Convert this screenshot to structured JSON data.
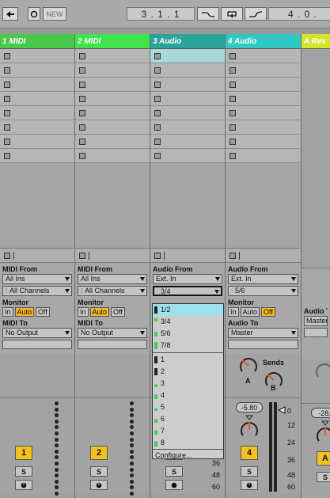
{
  "transport": {
    "back_icon": "arrow-left-icon",
    "overdub_icon": "circle-icon",
    "new_label": "NEW",
    "position_1": "3 .  1 .  1",
    "position_2": "4 .  0 ."
  },
  "tracks": [
    {
      "name": "1 MIDI",
      "color": "#49c94b",
      "number": "1"
    },
    {
      "name": "2 MIDI",
      "color": "#3fe34a",
      "number": "2"
    },
    {
      "name": "3 Audio",
      "color": "#2aa49a",
      "number": ""
    },
    {
      "name": "4 Audio",
      "color": "#2fc8c2",
      "number": "4"
    },
    {
      "name": "A Rev",
      "color": "#d3e52a",
      "number": "A"
    }
  ],
  "io": {
    "midi_from_label": "MIDI From",
    "audio_from_label": "Audio From",
    "all_ins": "All Ins",
    "all_channels": "All Channels",
    "ext_in": "Ext. In",
    "input_34": "3/4",
    "input_56": "5/6",
    "monitor_label": "Monitor",
    "mon_in": "In",
    "mon_auto": "Auto",
    "mon_off": "Off",
    "midi_to_label": "MIDI To",
    "audio_to_label": "Audio To",
    "audio_to_return": "Audio T",
    "no_output": "No Output",
    "master": "Master",
    "master_short": "Master"
  },
  "sends": {
    "label": "Sends",
    "a": "A",
    "b": "B"
  },
  "mixer": {
    "solo": "S",
    "volume_4": "-5.80",
    "volume_a": "-28.",
    "db_marks": [
      "0",
      "12",
      "24",
      "36",
      "48",
      "60"
    ]
  },
  "dropdown": {
    "items": [
      {
        "label": "1/2",
        "highlight": true
      },
      {
        "label": "3/4",
        "highlight": false
      },
      {
        "label": "5/6",
        "highlight": false
      },
      {
        "label": "7/8",
        "highlight": false
      },
      {
        "label": "1",
        "highlight": false
      },
      {
        "label": "2",
        "highlight": false
      },
      {
        "label": "3",
        "highlight": false
      },
      {
        "label": "4",
        "highlight": false
      },
      {
        "label": "5",
        "highlight": false
      },
      {
        "label": "6",
        "highlight": false
      },
      {
        "label": "7",
        "highlight": false
      },
      {
        "label": "8",
        "highlight": false
      }
    ],
    "configure": "Configure..."
  }
}
